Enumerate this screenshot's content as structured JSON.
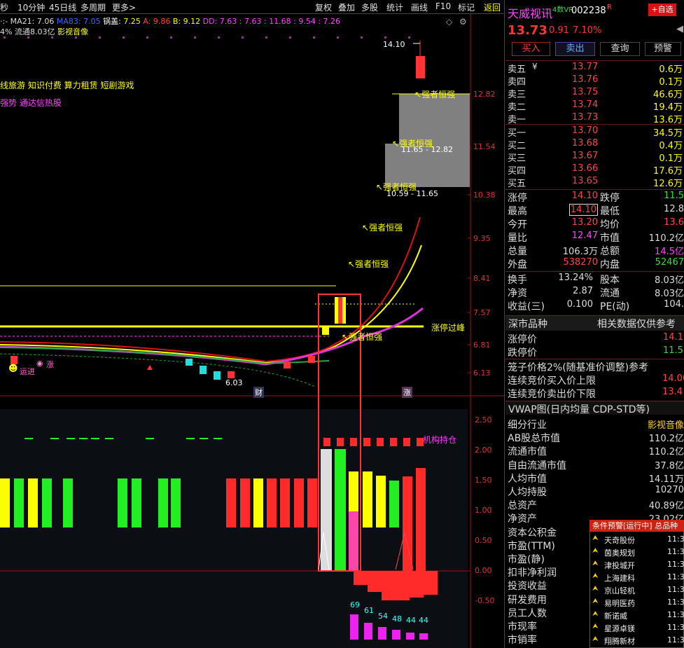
{
  "toolbar": {
    "left_items": [
      "秒",
      "10分钟",
      "45日线",
      "多周期",
      "更多>"
    ],
    "right_items": [
      "复权",
      "叠加",
      "多股",
      "统计",
      "画线",
      "F10",
      "标记"
    ],
    "back": "返回"
  },
  "ma_line": {
    "prefix": "·:-",
    "ma21": "MA21: 7.06",
    "ma83": "MA83: 7.05",
    "guogai_label": "锅盖:",
    "guogai_val": "7.25",
    "a_val": "A: 9.86",
    "b_val": "B: 9.12",
    "dd_val": "DD: 7.63 : 7.63 : 11.68 : 9.54 : 7.26"
  },
  "info_line": {
    "turnover": "4% 流通8.03亿",
    "industry": "影视音像"
  },
  "concepts": {
    "row1": "线旅游 知识付费 算力租赁 短剧游戏",
    "row2": "强势 通达信热股"
  },
  "price_axis": [
    "12.82",
    "11.54",
    "10.38",
    "9.35",
    "8.41",
    "7.57",
    "6.81",
    "6.13"
  ],
  "ind_axis": [
    "2.50",
    "2.00",
    "1.50",
    "1.00",
    "0.50",
    "0.00",
    "-0.50"
  ],
  "annotations": {
    "peak": "14.10",
    "strong": "强者恒强",
    "range1": "11.65 - 12.82",
    "range2": "10.59 - 11.65",
    "limit_peak": "涨停过峰",
    "low": "6.03",
    "zhang": "涨",
    "cai": "财",
    "zhangtag": "涨",
    "yunjin": "运进",
    "jigou": "机构持仓"
  },
  "bars_neg": [
    "69",
    "61",
    "54",
    "48",
    "44",
    "44"
  ],
  "stock": {
    "name": "天威视讯",
    "badge": "4数VR",
    "code": "002238",
    "r": "R",
    "price": "13.73",
    "change": "0.91",
    "pct": "7.10%",
    "add_btn": "+自选"
  },
  "actions": [
    "买入",
    "卖出",
    "查询",
    "预警"
  ],
  "asks": [
    {
      "label": "卖五",
      "p": "13.77",
      "v": "0.6万"
    },
    {
      "label": "卖四",
      "p": "13.76",
      "v": "0.1万"
    },
    {
      "label": "卖三",
      "p": "13.75",
      "v": "46.6万"
    },
    {
      "label": "卖二",
      "p": "13.74",
      "v": "19.4万"
    },
    {
      "label": "卖一",
      "p": "13.73",
      "v": "13.6万"
    }
  ],
  "bids": [
    {
      "label": "买一",
      "p": "13.70",
      "v": "34.5万"
    },
    {
      "label": "买二",
      "p": "13.68",
      "v": "0.4万"
    },
    {
      "label": "买三",
      "p": "13.67",
      "v": "0.1万"
    },
    {
      "label": "买四",
      "p": "13.66",
      "v": "17.6万"
    },
    {
      "label": "买五",
      "p": "13.65",
      "v": "12.6万"
    }
  ],
  "ask5_suffix": "¥",
  "stats": [
    {
      "l1": "涨停",
      "v1": "14.10",
      "l2": "跌停",
      "v2": "11.5"
    },
    {
      "l1": "最高",
      "v1": "14.10",
      "l2": "最低",
      "v2": "12.8"
    },
    {
      "l1": "今开",
      "v1": "13.20",
      "l2": "均价",
      "v2": "13.6"
    },
    {
      "l1": "量比",
      "v1": "12.47",
      "l2": "市值",
      "v2": "110.2亿"
    },
    {
      "l1": "总量",
      "v1": "106.3万",
      "l2": "总额",
      "v2": "14.5亿"
    },
    {
      "l1": "外盘",
      "v1": "538270",
      "l2": "内盘",
      "v2": "52467"
    }
  ],
  "stats2": [
    {
      "l1": "换手",
      "v1": "13.24%",
      "l2": "股本",
      "v2": "8.03亿"
    },
    {
      "l1": "净资",
      "v1": "2.87",
      "l2": "流通",
      "v2": "8.03亿"
    },
    {
      "l1": "收益(三)",
      "v1": "0.100",
      "l2": "PE(动)",
      "v2": "104."
    }
  ],
  "board": {
    "title": "深市品种",
    "ref": "相关数据仅供参考"
  },
  "limits": [
    {
      "l": "涨停价",
      "v": "14.10"
    },
    {
      "l": "跌停价",
      "v": "11.5"
    }
  ],
  "cage": {
    "title": "笼子价格2%(随基准价调整)参考",
    "rows": [
      {
        "l": "连续竞价买入价上限",
        "v": "14.00"
      },
      {
        "l": "连续竞价卖出价下限",
        "v": "13.4"
      }
    ]
  },
  "vwap": "VWAP图(日内均量 CDP-STD等)",
  "fundamentals": [
    {
      "l": "细分行业",
      "v": "影视音像"
    },
    {
      "l": "AB股总市值",
      "v": "110.2亿"
    },
    {
      "l": "流通市值",
      "v": "110.2亿"
    },
    {
      "l": "自由流通市值",
      "v": "37.8亿"
    },
    {
      "l": "人均市值",
      "v": "14.11万"
    },
    {
      "l": "人均持股",
      "v": "10270"
    },
    {
      "l": "总资产",
      "v": "40.89亿"
    },
    {
      "l": "净资产",
      "v": "23.02亿"
    },
    {
      "l": "资本公积金",
      "v": ""
    },
    {
      "l": "市盈(TTM)",
      "v": ""
    },
    {
      "l": "市盈(静)",
      "v": ""
    },
    {
      "l": "扣非净利润",
      "v": ""
    },
    {
      "l": "投资收益",
      "v": ""
    },
    {
      "l": "研发费用",
      "v": ""
    },
    {
      "l": "员工人数",
      "v": ""
    },
    {
      "l": "市现率",
      "v": ""
    },
    {
      "l": "市销率",
      "v": ""
    }
  ],
  "alerts": {
    "title": "条件预警[运行中] 总品种",
    "items": [
      {
        "name": "天奇股份",
        "t": "11:3"
      },
      {
        "name": "茵奥规划",
        "t": "11:3"
      },
      {
        "name": "津投城开",
        "t": "11:3"
      },
      {
        "name": "上海建科",
        "t": "11:3"
      },
      {
        "name": "京山轻机",
        "t": "11:3"
      },
      {
        "name": "易明医药",
        "t": "11:3"
      },
      {
        "name": "新诺威",
        "t": "11:3"
      },
      {
        "name": "星源卓镁",
        "t": "11:3"
      },
      {
        "name": "翔腾新材",
        "t": "11:3"
      }
    ]
  },
  "colors": {
    "red": "#ff2a2a",
    "green": "#22dd22",
    "yellow": "#ffff00",
    "magenta": "#ff22ff",
    "cyan": "#00ffff",
    "axis": "#cc2222"
  }
}
